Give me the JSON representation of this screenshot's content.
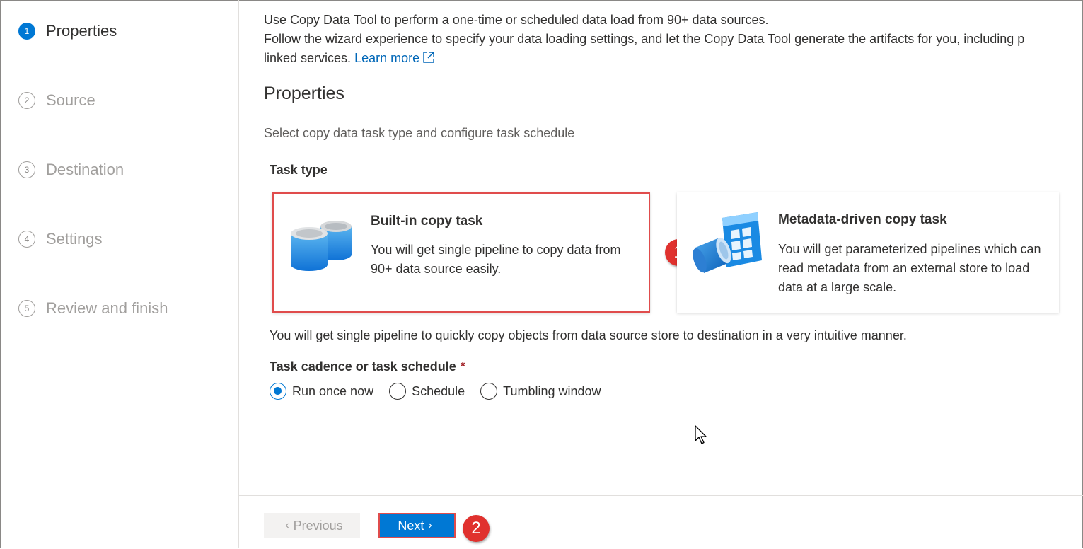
{
  "steps": [
    {
      "number": "1",
      "label": "Properties",
      "active": true
    },
    {
      "number": "2",
      "label": "Source",
      "active": false
    },
    {
      "number": "3",
      "label": "Destination",
      "active": false
    },
    {
      "number": "4",
      "label": "Settings",
      "active": false
    },
    {
      "number": "5",
      "label": "Review and finish",
      "active": false
    }
  ],
  "intro": {
    "line1": "Use Copy Data Tool to perform a one-time or scheduled data load from 90+ data sources.",
    "line2": "Follow the wizard experience to specify your data loading settings, and let the Copy Data Tool generate the artifacts for you, including p",
    "line3": "linked services.",
    "learn_more": "Learn more"
  },
  "section": {
    "title": "Properties",
    "description": "Select copy data task type and configure task schedule",
    "task_type_label": "Task type"
  },
  "cards": {
    "builtin": {
      "title": "Built-in copy task",
      "description": "You will get single pipeline to copy data from 90+ data source easily.",
      "selected": true
    },
    "metadata": {
      "title": "Metadata-driven copy task",
      "description": "You will get parameterized pipelines which can read metadata from an external store to load data at a large scale.",
      "selected": false
    }
  },
  "task_hint": "You will get single pipeline to quickly copy objects from data source store to destination in a very intuitive manner.",
  "cadence": {
    "label": "Task cadence or task schedule",
    "required_mark": "*",
    "options": [
      {
        "label": "Run once now",
        "checked": true
      },
      {
        "label": "Schedule",
        "checked": false
      },
      {
        "label": "Tumbling window",
        "checked": false
      }
    ]
  },
  "footer": {
    "previous_label": "Previous",
    "next_label": "Next"
  },
  "callouts": {
    "one": "1",
    "two": "2"
  },
  "colors": {
    "accent": "#0078d4",
    "callout": "#e0312e",
    "highlight_border": "#e04c4c"
  }
}
